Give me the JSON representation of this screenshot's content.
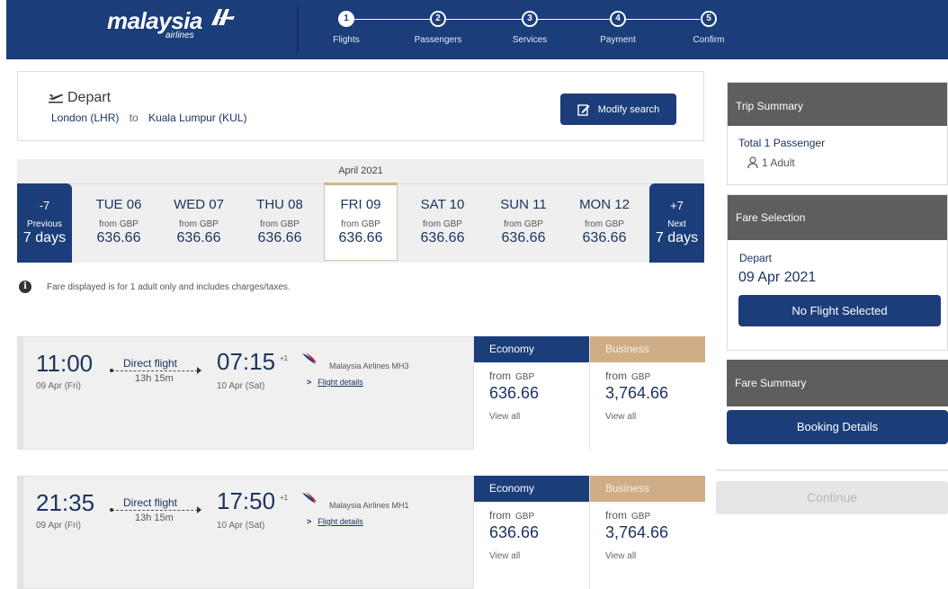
{
  "brand": {
    "name": "malaysia",
    "sub": "airlines"
  },
  "steps": [
    {
      "num": "1",
      "label": "Flights",
      "active": true
    },
    {
      "num": "2",
      "label": "Passengers"
    },
    {
      "num": "3",
      "label": "Services"
    },
    {
      "num": "4",
      "label": "Payment"
    },
    {
      "num": "5",
      "label": "Confirm"
    }
  ],
  "route": {
    "title": "Depart",
    "origin": "London (LHR)",
    "to": "to",
    "destination": "Kuala Lumpur (KUL)",
    "modify_label": "Modify search"
  },
  "date_strip": {
    "month": "April 2021",
    "prev": {
      "big": "-7",
      "small": "Previous",
      "days": "7 days"
    },
    "next": {
      "big": "+7",
      "small": "Next",
      "days": "7 days"
    },
    "days": [
      {
        "label": "TUE 06",
        "from": "from GBP",
        "price": "636.66"
      },
      {
        "label": "WED 07",
        "from": "from GBP",
        "price": "636.66"
      },
      {
        "label": "THU 08",
        "from": "from GBP",
        "price": "636.66"
      },
      {
        "label": "FRI 09",
        "from": "from GBP",
        "price": "636.66",
        "selected": true
      },
      {
        "label": "SAT 10",
        "from": "from GBP",
        "price": "636.66"
      },
      {
        "label": "SUN 11",
        "from": "from GBP",
        "price": "636.66"
      },
      {
        "label": "MON 12",
        "from": "from GBP",
        "price": "636.66"
      }
    ]
  },
  "info_text": "Fare displayed is for 1 adult only and includes charges/taxes.",
  "flights": [
    {
      "dep_time": "11:00",
      "dep_date": "09 Apr (Fri)",
      "type": "Direct flight",
      "duration": "13h 15m",
      "arr_time": "07:15",
      "plus": "+1",
      "arr_date": "10 Apr (Sat)",
      "airline": "Malaysia Airlines MH3",
      "details": "Flight details",
      "economy": {
        "label": "Economy",
        "from": "from",
        "currency": "GBP",
        "price": "636.66",
        "view": "View all"
      },
      "business": {
        "label": "Business",
        "from": "from",
        "currency": "GBP",
        "price": "3,764.66",
        "view": "View all"
      }
    },
    {
      "dep_time": "21:35",
      "dep_date": "09 Apr (Fri)",
      "type": "Direct flight",
      "duration": "13h 15m",
      "arr_time": "17:50",
      "plus": "+1",
      "arr_date": "10 Apr (Sat)",
      "airline": "Malaysia Airlines MH1",
      "details": "Flight details",
      "economy": {
        "label": "Economy",
        "from": "from",
        "currency": "GBP",
        "price": "636.66",
        "view": "View all"
      },
      "business": {
        "label": "Business",
        "from": "from",
        "currency": "GBP",
        "price": "3,764.66",
        "view": "View all"
      }
    }
  ],
  "sidebar": {
    "trip_summary": {
      "title": "Trip Summary",
      "total": "Total 1 Passenger",
      "adult": "1 Adult"
    },
    "fare_selection": {
      "title": "Fare Selection",
      "depart": "Depart",
      "date": "09 Apr 2021",
      "no_flight": "No Flight Selected"
    },
    "fare_summary": {
      "title": "Fare Summary",
      "booking": "Booking Details"
    },
    "continue_label": "Continue"
  },
  "colors": {
    "primary": "#1b3d7a",
    "business": "#cfae87",
    "panel_head": "#5e5e5e"
  },
  "icons": [
    "airplane-depart-icon",
    "edit-icon",
    "info-icon",
    "arrow-icon",
    "chevron-right-icon",
    "airline-logo-icon",
    "person-icon"
  ]
}
